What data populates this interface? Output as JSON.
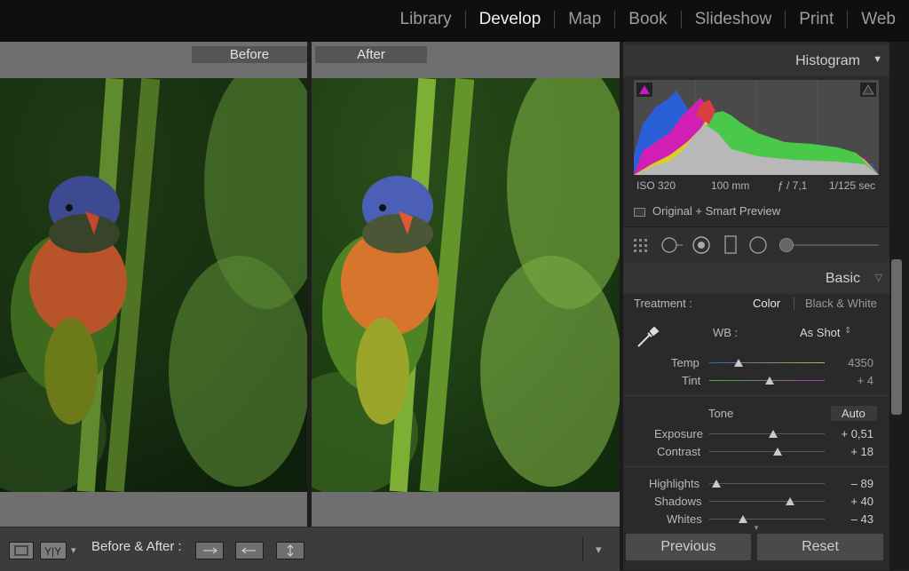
{
  "modules": [
    "Library",
    "Develop",
    "Map",
    "Book",
    "Slideshow",
    "Print",
    "Web"
  ],
  "active_module": "Develop",
  "view": {
    "before_label": "Before",
    "after_label": "After"
  },
  "toolbar": {
    "before_after_label": "Before & After :"
  },
  "histogram": {
    "title": "Histogram",
    "iso": "ISO 320",
    "focal": "100 mm",
    "aperture": "ƒ / 7,1",
    "shutter": "1/125 sec",
    "preview_label": "Original + Smart Preview"
  },
  "basic": {
    "title": "Basic",
    "treatment_label": "Treatment :",
    "treatment_color": "Color",
    "treatment_bw": "Black & White",
    "wb_label": "WB :",
    "wb_value": "As Shot",
    "tone_label": "Tone",
    "auto_label": "Auto",
    "sliders": [
      {
        "label": "Temp",
        "value": "4350",
        "position": 0.25
      },
      {
        "label": "Tint",
        "value": "+ 4",
        "position": 0.52
      },
      {
        "label": "Exposure",
        "value": "+ 0,51",
        "position": 0.55
      },
      {
        "label": "Contrast",
        "value": "+ 18",
        "position": 0.59
      },
      {
        "label": "Highlights",
        "value": "– 89",
        "position": 0.06
      },
      {
        "label": "Shadows",
        "value": "+ 40",
        "position": 0.7
      },
      {
        "label": "Whites",
        "value": "– 43",
        "position": 0.29
      }
    ]
  },
  "buttons": {
    "previous": "Previous",
    "reset": "Reset"
  }
}
